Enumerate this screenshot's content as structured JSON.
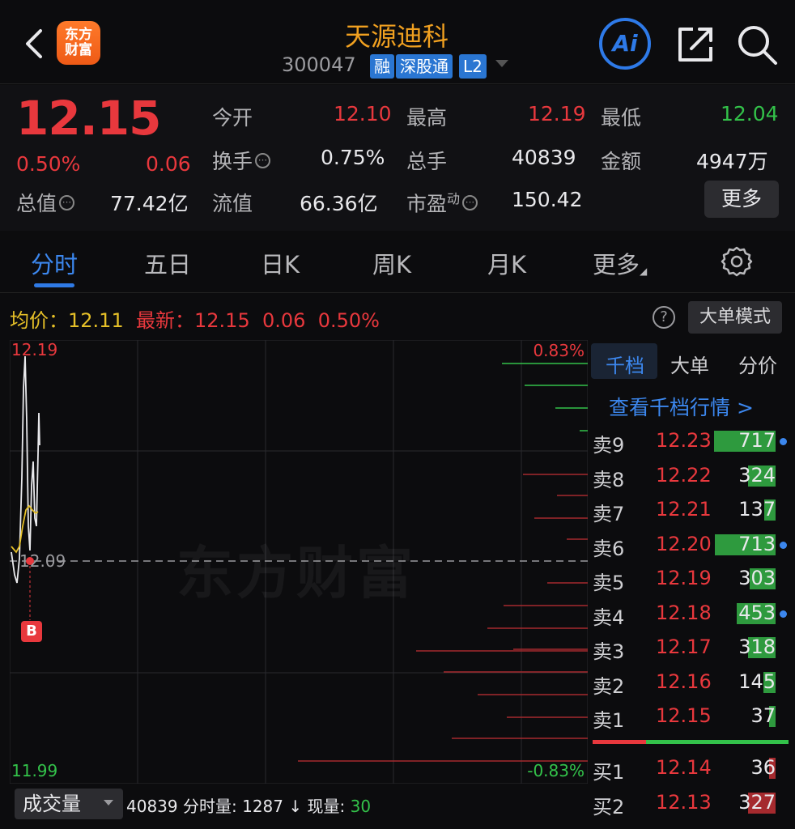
{
  "header": {
    "logo_line1": "东方",
    "logo_line2": "财富",
    "title": "天源迪科",
    "code": "300047",
    "tags": [
      "融",
      "深股通",
      "L2"
    ],
    "ai_label": "Ai"
  },
  "quote": {
    "price": "12.15",
    "change_pct": "0.50%",
    "change": "0.06",
    "total_value_label": "总值",
    "total_value": "77.42亿",
    "open_label": "今开",
    "open": "12.10",
    "high_label": "最高",
    "high": "12.19",
    "low_label": "最低",
    "low": "12.04",
    "turnover_label": "换手",
    "turnover": "0.75%",
    "volume_label": "总手",
    "volume": "40839",
    "amount_label": "金额",
    "amount": "4947万",
    "float_value_label": "流值",
    "float_value": "66.36亿",
    "pe_label": "市盈",
    "pe_sup": "动",
    "pe": "150.42",
    "more_label": "更多"
  },
  "tabs": [
    "分时",
    "五日",
    "日K",
    "周K",
    "月K",
    "更多"
  ],
  "stats": {
    "avg_label": "均价：",
    "avg": "12.11",
    "latest_label": "最新：",
    "latest": "12.15",
    "latest_change": "0.06",
    "latest_pct": "0.50%",
    "help_icon": "?",
    "big_order_label": "大单模式"
  },
  "chart": {
    "y_top": "12.19",
    "y_bottom": "11.99",
    "y_mid": "12.09",
    "pct_top": "0.83%",
    "pct_bottom": "-0.83%",
    "watermark": "东方财富",
    "b_marker": "B"
  },
  "orderbook": {
    "tabs": [
      "千档",
      "大单",
      "分价"
    ],
    "view_1000": "查看千档行情 >",
    "asks": [
      {
        "label": "卖9",
        "price": "12.23",
        "vol": "717",
        "fill": 0.95,
        "dot": true
      },
      {
        "label": "卖8",
        "price": "12.22",
        "vol": "324",
        "fill": 0.43,
        "dot": false
      },
      {
        "label": "卖7",
        "price": "12.21",
        "vol": "137",
        "fill": 0.18,
        "dot": false
      },
      {
        "label": "卖6",
        "price": "12.20",
        "vol": "713",
        "fill": 0.94,
        "dot": true
      },
      {
        "label": "卖5",
        "price": "12.19",
        "vol": "303",
        "fill": 0.4,
        "dot": false
      },
      {
        "label": "卖4",
        "price": "12.18",
        "vol": "453",
        "fill": 0.6,
        "dot": true
      },
      {
        "label": "卖3",
        "price": "12.17",
        "vol": "318",
        "fill": 0.42,
        "dot": false
      },
      {
        "label": "卖2",
        "price": "12.16",
        "vol": "145",
        "fill": 0.19,
        "dot": false
      },
      {
        "label": "卖1",
        "price": "12.15",
        "vol": "37",
        "fill": 0.06,
        "dot": false
      }
    ],
    "bids": [
      {
        "label": "买1",
        "price": "12.14",
        "vol": "36",
        "fill": 0.05
      },
      {
        "label": "买2",
        "price": "12.13",
        "vol": "327",
        "fill": 0.43
      }
    ]
  },
  "volume_bar": {
    "select_label": "成交量",
    "total": "40839",
    "tick_label": "分时量: ",
    "tick_vol": "1287",
    "arrow": "↓",
    "now_label": "现量: ",
    "now_vol": "30"
  },
  "colors": {
    "up": "#e8383d",
    "down": "#33c24a",
    "accent": "#2f7ae5",
    "avg_line": "#e6c028",
    "title": "#f0a020"
  }
}
